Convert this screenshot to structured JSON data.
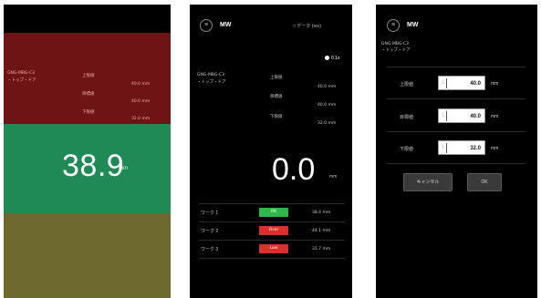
{
  "screen1": {
    "value": "38.9",
    "unit": "mm",
    "info_left": [
      "GNG-MBG-C3",
      "・トップ・ドア"
    ],
    "levels": [
      "上限値",
      "目標値",
      "下限値"
    ],
    "readings": [
      "40.0 mm",
      "40.0 mm",
      "32.0 mm"
    ],
    "colors": {
      "top": "#6e1414",
      "mid": "#1f8a55",
      "bottom": "#6e6a2f"
    }
  },
  "screen2": {
    "title": "MW",
    "menu_icon": "hamburger-icon",
    "header_right": "□ データ (rev)",
    "record_label": "0.1s",
    "info_left": [
      "GNG-MBG-C3",
      "・トップ・ドア"
    ],
    "levels": [
      "上限値",
      "目標値",
      "下限値"
    ],
    "readings": [
      "40.0 mm",
      "40.0 mm",
      "32.0 mm"
    ],
    "value": "0.0",
    "unit": "mm",
    "rows": [
      {
        "label": "ワーク 1",
        "badge": "OK",
        "badge_color": "#2fb84a",
        "value": "38.4 mm"
      },
      {
        "label": "ワーク 2",
        "badge": "Over",
        "badge_color": "#d9302c",
        "value": "44.1 mm"
      },
      {
        "label": "ワーク 3",
        "badge": "Low",
        "badge_color": "#d9302c",
        "value": "31.7 mm"
      }
    ]
  },
  "screen3": {
    "title": "MW",
    "menu_icon": "hamburger-icon",
    "info": [
      "GNG-MBG-C3",
      "・トップ・ドア"
    ],
    "fields": [
      {
        "label": "上限値",
        "prefix": "1",
        "value": "40.0",
        "unit": "mm"
      },
      {
        "label": "目標値",
        "prefix": "1",
        "value": "40.0",
        "unit": "mm"
      },
      {
        "label": "下限値",
        "prefix": "1",
        "value": "32.0",
        "unit": "mm"
      }
    ],
    "buttons": {
      "cancel": "キャンセル",
      "ok": "OK"
    }
  }
}
